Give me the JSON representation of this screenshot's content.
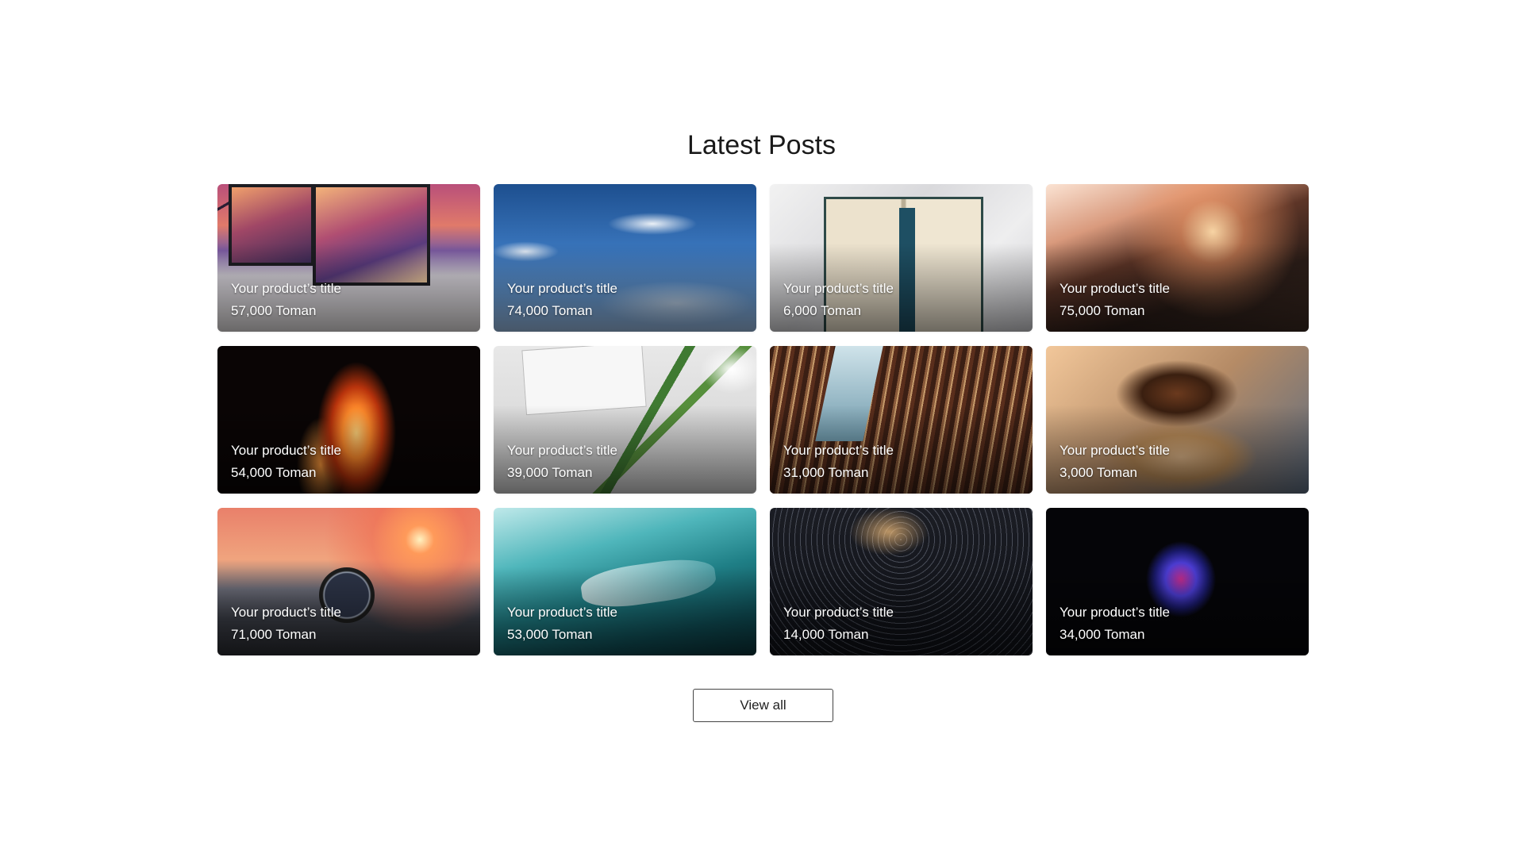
{
  "section": {
    "title": "Latest Posts"
  },
  "posts": [
    {
      "title": "Your product’s title",
      "price": "57,000 Toman",
      "image": "desk-setup-monitors"
    },
    {
      "title": "Your product’s title",
      "price": "74,000 Toman",
      "image": "blue-sky-clouds"
    },
    {
      "title": "Your product’s title",
      "price": "6,000 Toman",
      "image": "open-book"
    },
    {
      "title": "Your product’s title",
      "price": "75,000 Toman",
      "image": "desert-dune-jumper"
    },
    {
      "title": "Your product’s title",
      "price": "54,000 Toman",
      "image": "fire-flames"
    },
    {
      "title": "Your product’s title",
      "price": "39,000 Toman",
      "image": "notebook-tulips"
    },
    {
      "title": "Your product’s title",
      "price": "31,000 Toman",
      "image": "library-bookshelves"
    },
    {
      "title": "Your product’s title",
      "price": "3,000 Toman",
      "image": "sprinkled-donuts"
    },
    {
      "title": "Your product’s title",
      "price": "71,000 Toman",
      "image": "watch-at-sunset"
    },
    {
      "title": "Your product’s title",
      "price": "53,000 Toman",
      "image": "turquoise-ice-cave"
    },
    {
      "title": "Your product’s title",
      "price": "14,000 Toman",
      "image": "star-trails-night"
    },
    {
      "title": "Your product’s title",
      "price": "34,000 Toman",
      "image": "glitter-face-dark"
    }
  ],
  "actions": {
    "view_all_label": "View all"
  }
}
